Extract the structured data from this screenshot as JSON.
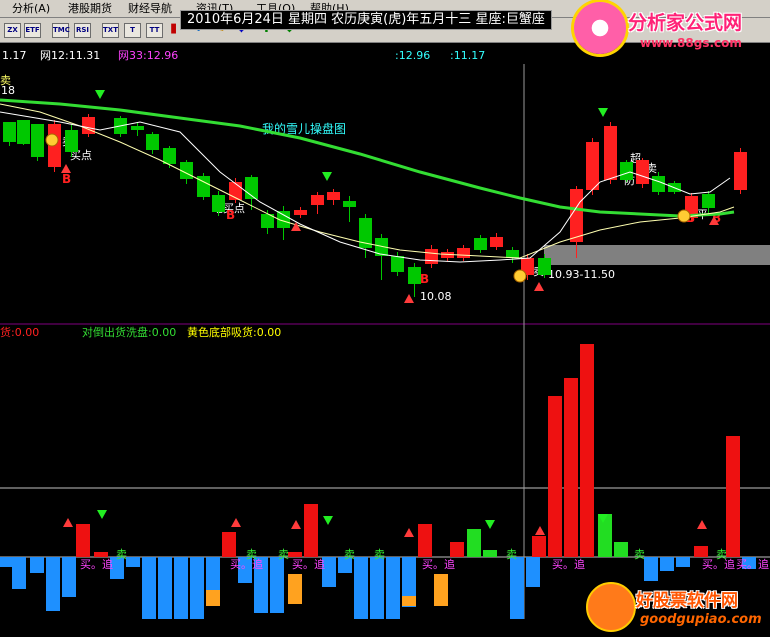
{
  "menu": {
    "items": [
      "分析(A)",
      "港股期货",
      "财经导航",
      "资讯(T)",
      "工具(O)",
      "帮助(H)"
    ]
  },
  "date_banner": "2010年6月24日  星期四  农历庚寅(虎)年五月十三   星座:巨蟹座",
  "toolbar": {
    "buttons": [
      "ZX",
      "ETF",
      "TMC",
      "RSI",
      "TXT",
      "T",
      "TT"
    ]
  },
  "logos": {
    "top_name": "分析家公式网",
    "top_url": "www.88gs.com",
    "bottom_name": "好股票软件网",
    "bottom_url": "goodgupiao.com"
  },
  "main_chart": {
    "header": {
      "price_a": "1.17",
      "time_a": "网12:11.31",
      "time_b": "网33:12.96",
      "price_b": ":12.96",
      "price_c": ":11.17"
    },
    "left_value": "18",
    "annotations": {
      "title_note": "我的雪儿操盘图",
      "buy_point_1": "买点",
      "buy_point_2": "地买点",
      "low_price": "10.08",
      "range_label": "10.93-11.50",
      "label_sell_1": "卖",
      "label_sell_2": "卖",
      "label_sell_3": "卖",
      "label_sell_4": "卖",
      "label_fang": "防",
      "label_chao": "超",
      "label_b1": "B",
      "label_b2": "B",
      "label_b3": "B",
      "label_b4": "B",
      "label_b5": "B",
      "label_ping": "平"
    },
    "colors": {
      "up": "#ff2020",
      "down": "#00c800",
      "ma_slow": "#33dd33",
      "ma_fast": "#ffffb0",
      "ma_mid": "#ffffff",
      "zone": "#808080"
    }
  },
  "sub_chart": {
    "header": {
      "label_left": "货:0.00",
      "label_mid": "对倒出货洗盘:0.00",
      "label_right": "黄色底部吸货:0.00"
    },
    "annotations": {
      "b1": "买。追",
      "b2": "买。追",
      "b3": "买。追",
      "b4": "买。追",
      "b5": "买。追",
      "b6": "买。追",
      "b7": "买。追",
      "s1": "卖",
      "s2": "卖",
      "s3": "卖",
      "s4": "卖",
      "s5": "卖",
      "s6": "卖",
      "s7": "卖",
      "s8": "卖"
    }
  }
}
